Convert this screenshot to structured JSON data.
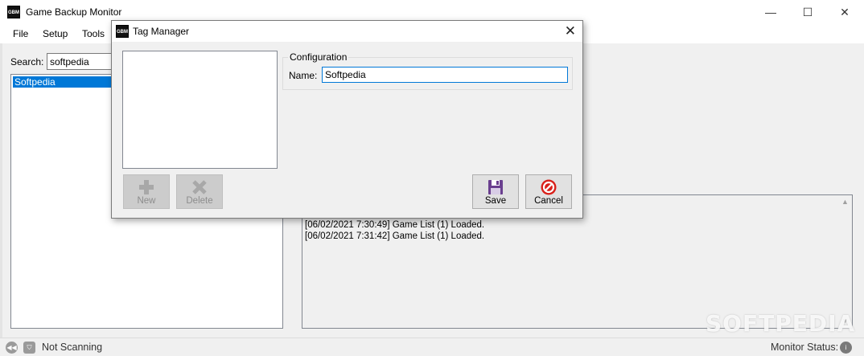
{
  "main_window": {
    "title": "Game Backup Monitor",
    "icon_text": "GBM",
    "controls": {
      "minimize": "—",
      "maximize": "☐",
      "close": "✕"
    }
  },
  "menu": {
    "items": [
      {
        "label": "File"
      },
      {
        "label": "Setup"
      },
      {
        "label": "Tools"
      }
    ]
  },
  "search": {
    "label": "Search:",
    "value": "softpedia"
  },
  "game_list": {
    "items": [
      {
        "label": "Softpedia",
        "selected": true
      }
    ]
  },
  "log": {
    "lines": [
      "[06/02/2021 7:30:49] Game List (1) Loaded.",
      "[06/02/2021 7:31:42] Game List (1) Loaded."
    ]
  },
  "status_bar": {
    "scan_status": "Not Scanning",
    "monitor_label": "Monitor Status:"
  },
  "dialog": {
    "title": "Tag Manager",
    "icon_text": "GBM",
    "close": "✕",
    "new_label": "New",
    "delete_label": "Delete",
    "group_label": "Configuration",
    "name_label": "Name:",
    "name_value": "Softpedia",
    "save_label": "Save",
    "cancel_label": "Cancel"
  },
  "watermark": "SOFTPEDIA",
  "colors": {
    "selection": "#0078d7",
    "window_bg": "#f0f0f0",
    "cancel_icon": "#d9201a",
    "save_icon": "#6a3f8f"
  }
}
